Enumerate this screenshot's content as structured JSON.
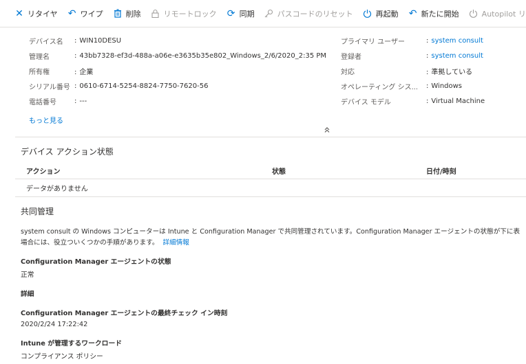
{
  "toolbar": {
    "retire": "リタイヤ",
    "wipe": "ワイプ",
    "delete": "削除",
    "remote_lock": "リモートロック",
    "sync": "同期",
    "passcode_reset": "パスコードのリセット",
    "restart": "再起動",
    "fresh_start": "新たに開始",
    "autopilot_reset": "Autopilot リセット"
  },
  "essentials": {
    "left": [
      {
        "label": "デバイス名",
        "value": "WIN10DESU"
      },
      {
        "label": "管理名",
        "value": "43bb7328-ef3d-488a-a06e-e3635b35e802_Windows_2/6/2020_2:35 PM"
      },
      {
        "label": "所有権",
        "value": "企業"
      },
      {
        "label": "シリアル番号",
        "value": "0610-6714-5254-8824-7750-7620-56"
      },
      {
        "label": "電話番号",
        "value": "---"
      }
    ],
    "right": [
      {
        "label": "プライマリ ユーザー",
        "value": "system consult"
      },
      {
        "label": "登録者",
        "value": "system consult"
      },
      {
        "label": "対応",
        "value": "準拠している"
      },
      {
        "label": "オペレーティング シス...",
        "value": "Windows"
      },
      {
        "label": "デバイス モデル",
        "value": "Virtual Machine"
      }
    ],
    "colon": ":",
    "more_link": "もっと見る",
    "collapse_glyph": "≈"
  },
  "actions": {
    "title": "デバイス アクション状態",
    "columns": [
      "アクション",
      "状態",
      "日付/時刻"
    ],
    "empty": "データがありません"
  },
  "comanagement": {
    "title": "共同管理",
    "desc_line1": "system consult の Windows コンピューターは Intune と Configuration Manager で共同管理されています。Configuration Manager エージェントの状態が下に表",
    "desc_line2": "場合には、役立ついくつかの手順があります。",
    "details_link": "詳細情報",
    "agent_state_label": "Configuration Manager エージェントの状態",
    "agent_state_value": "正常",
    "details_heading": "詳細",
    "last_checkin_label": "Configuration Manager エージェントの最終チェック イン時刻",
    "last_checkin_value": "2020/2/24 17:22:42",
    "workload_label": "Intune が管理するワークロード",
    "workload_value": "コンプライアンス ポリシー"
  }
}
